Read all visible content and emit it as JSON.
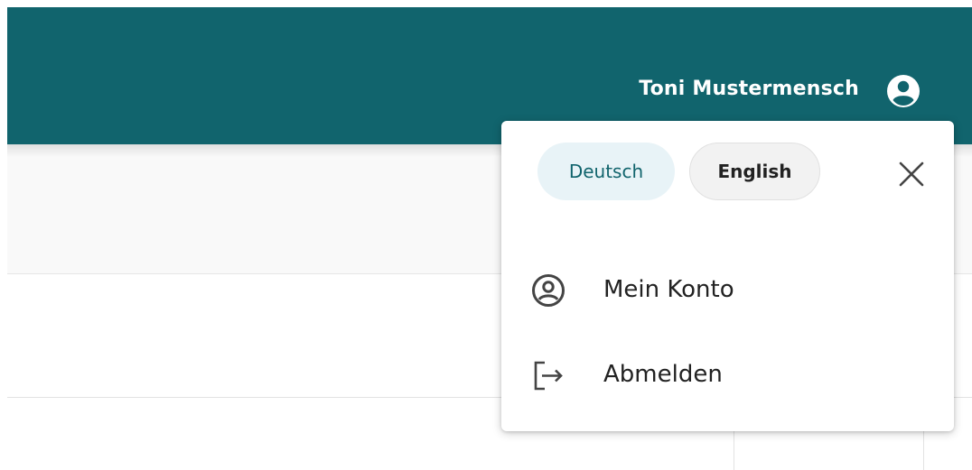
{
  "header": {
    "user_name": "Toni Mustermensch",
    "background_color": "#11646d",
    "account_icon": "account-circle-icon"
  },
  "user_menu": {
    "languages": [
      {
        "label": "Deutsch",
        "selected": true
      },
      {
        "label": "English",
        "selected": false
      }
    ],
    "close_icon": "close-icon",
    "items": [
      {
        "label": "Mein Konto",
        "icon": "account-circle-outline-icon"
      },
      {
        "label": "Abmelden",
        "icon": "logout-icon"
      }
    ]
  }
}
